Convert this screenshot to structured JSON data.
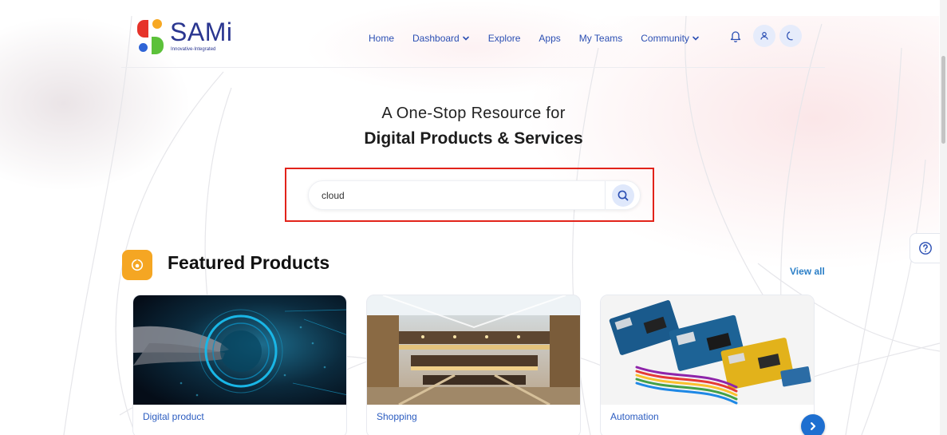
{
  "brand": {
    "name": "SAMi",
    "tagline": "Innovative-Integrated"
  },
  "nav": {
    "items": [
      {
        "label": "Home",
        "dropdown": false
      },
      {
        "label": "Dashboard",
        "dropdown": true
      },
      {
        "label": "Explore",
        "dropdown": false
      },
      {
        "label": "Apps",
        "dropdown": false
      },
      {
        "label": "My Teams",
        "dropdown": false
      },
      {
        "label": "Community",
        "dropdown": true
      }
    ],
    "icons": [
      "bell-icon",
      "user-icon",
      "moon-icon"
    ]
  },
  "hero": {
    "line1": "A One-Stop Resource for",
    "line2": "Digital Products & Services"
  },
  "search": {
    "value": "cloud"
  },
  "featured": {
    "title": "Featured Products",
    "view_all": "View all",
    "cards": [
      {
        "label": "Digital product",
        "image": "5g-hand-image"
      },
      {
        "label": "Shopping",
        "image": "shopping-mall-image"
      },
      {
        "label": "Automation",
        "image": "circuit-boards-image"
      }
    ]
  },
  "colors": {
    "accent": "#2b4fb3",
    "highlight": "#e2231a",
    "featured_icon": "#f5a623"
  }
}
